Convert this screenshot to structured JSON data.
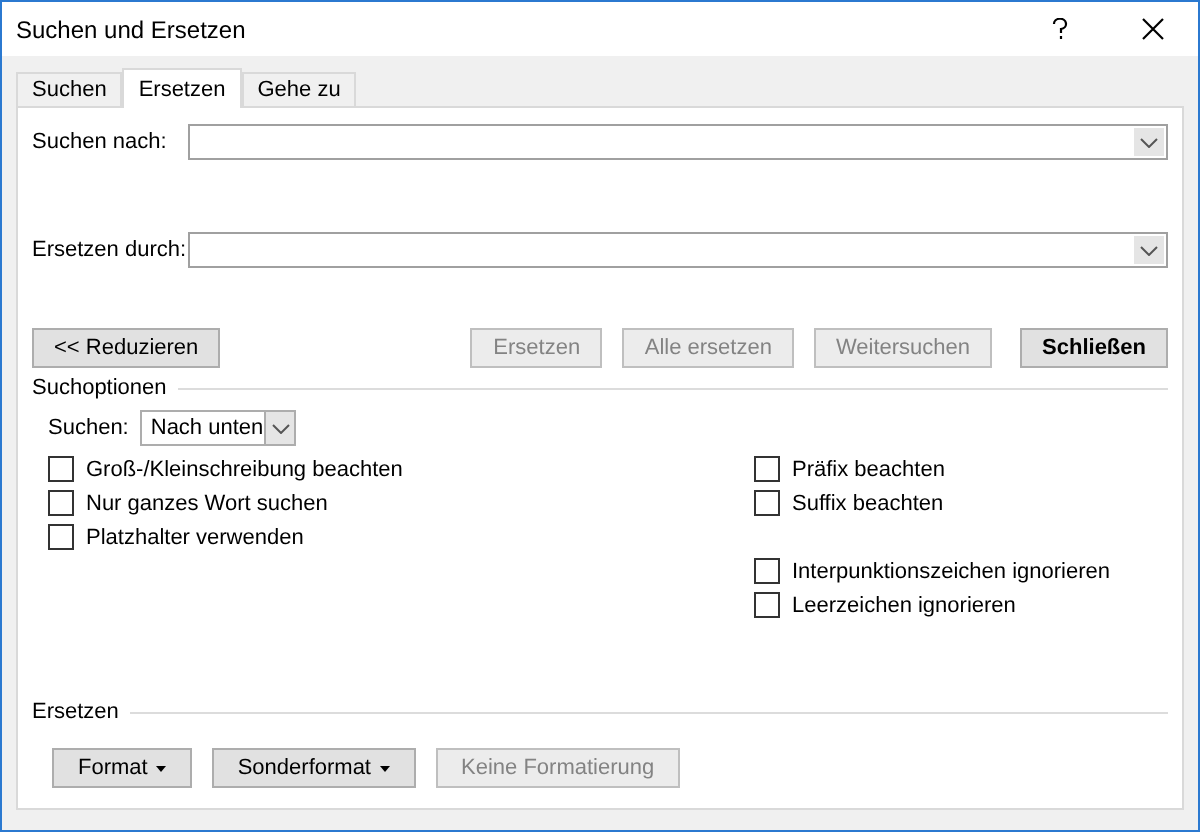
{
  "window": {
    "title": "Suchen und Ersetzen"
  },
  "tabs": [
    {
      "label": "Suchen",
      "selected": false
    },
    {
      "label": "Ersetzen",
      "selected": true
    },
    {
      "label": "Gehe zu",
      "selected": false
    }
  ],
  "fields": [
    {
      "label": "Suchen nach:"
    },
    {
      "label": "Ersetzen durch:"
    }
  ],
  "less_button": {
    "label": "<< Reduzieren"
  },
  "actions": [
    {
      "label": "Ersetzen",
      "disabled": true,
      "default": false
    },
    {
      "label": "Alle ersetzen",
      "disabled": true,
      "default": false
    },
    {
      "label": "Weitersuchen",
      "disabled": true,
      "default": false
    },
    {
      "label": "Schließen",
      "disabled": false,
      "default": true
    }
  ],
  "search_options": {
    "title": "Suchoptionen",
    "direction_label": "Suchen:",
    "direction_value": "Nach unten",
    "left": [
      {
        "label": "Groß-/Kleinschreibung beachten",
        "checked": false
      },
      {
        "label": "Nur ganzes Wort suchen",
        "checked": false
      },
      {
        "label": "Platzhalter verwenden",
        "checked": false
      }
    ],
    "right_groups": [
      [
        {
          "label": "Präfix beachten",
          "checked": false
        },
        {
          "label": "Suffix beachten",
          "checked": false
        }
      ],
      [
        {
          "label": "Interpunktionszeichen ignorieren",
          "checked": false
        },
        {
          "label": "Leerzeichen ignorieren",
          "checked": false
        }
      ]
    ]
  },
  "replace_section": {
    "title": "Ersetzen",
    "buttons": [
      {
        "label": "Format",
        "menu": true,
        "disabled": false
      },
      {
        "label": "Sonderformat",
        "menu": true,
        "disabled": false
      },
      {
        "label": "Keine Formatierung",
        "menu": false,
        "disabled": true
      }
    ]
  }
}
